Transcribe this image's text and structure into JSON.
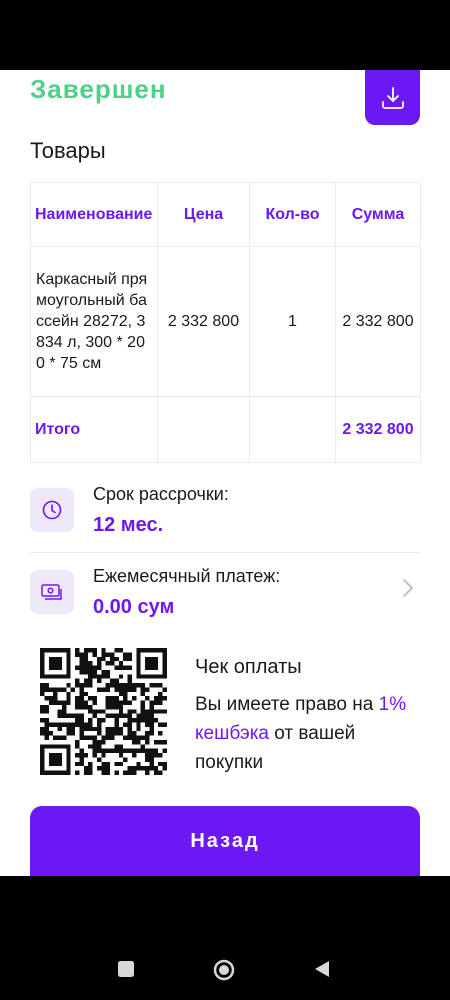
{
  "header": {
    "status": "Завершен",
    "download_icon": "download-icon"
  },
  "goods": {
    "title": "Товары",
    "columns": [
      "Наименование",
      "Цена",
      "Кол-во",
      "Сумма"
    ],
    "rows": [
      {
        "name": "Каркасный прямоугольный бассейн 28272, 3834 л, 300 * 200 * 75 см",
        "price": "2 332 800",
        "qty": "1",
        "sum": "2 332 800"
      }
    ],
    "total_label": "Итого",
    "total_value": "2 332 800"
  },
  "installment": {
    "label": "Срок рассрочки:",
    "value": "12 мес.",
    "icon": "clock-icon"
  },
  "monthly": {
    "label": "Ежемесячный платеж:",
    "value": "0.00 сум",
    "icon": "cash-icon"
  },
  "receipt": {
    "title": "Чек оплаты",
    "text_before": "Вы имеете право на",
    "accent": "1% кешбэка",
    "text_after": "от вашей покупки"
  },
  "back_button": "Назад",
  "colors": {
    "accent": "#6b18f5",
    "success": "#4fd08a"
  }
}
